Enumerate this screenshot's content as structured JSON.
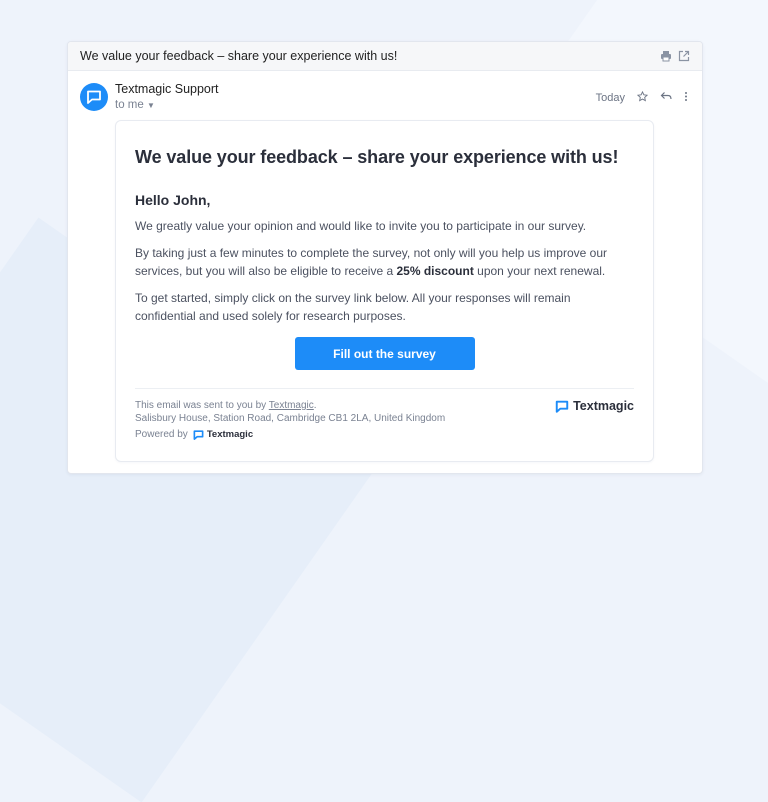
{
  "colors": {
    "accent": "#1d8cf8",
    "text_dark": "#2b2f3b",
    "text_muted": "#7a8292"
  },
  "subject": "We value your feedback – share your experience with us!",
  "toolbar_icons": [
    "print-icon",
    "open-in-new-window-icon"
  ],
  "sender": {
    "name": "Textmagic Support",
    "recipient": "to me"
  },
  "meta": {
    "date": "Today"
  },
  "email": {
    "headline": "We value your feedback – share your experience with us!",
    "greeting": "Hello John,",
    "p1": "We greatly value your opinion and would like to invite you to participate in our survey.",
    "p2_before": "By taking just a few minutes to complete the survey, not only will you help us improve our services, but you will also be eligible to receive a ",
    "p2_bold": "25% discount",
    "p2_after": " upon your next renewal.",
    "p3": "To get started, simply click on the survey link below. All your responses will remain confidential and used solely for research purposes.",
    "cta": "Fill out the survey",
    "footer_sent_prefix": "This email was sent to you by ",
    "footer_sent_link": "Textmagic",
    "footer_sent_suffix": ".",
    "footer_address": "Salisbury House, Station Road, Cambridge CB1 2LA, United Kingdom",
    "brand": "Textmagic",
    "powered_by": "Powered by",
    "powered_brand": "Textmagic"
  }
}
